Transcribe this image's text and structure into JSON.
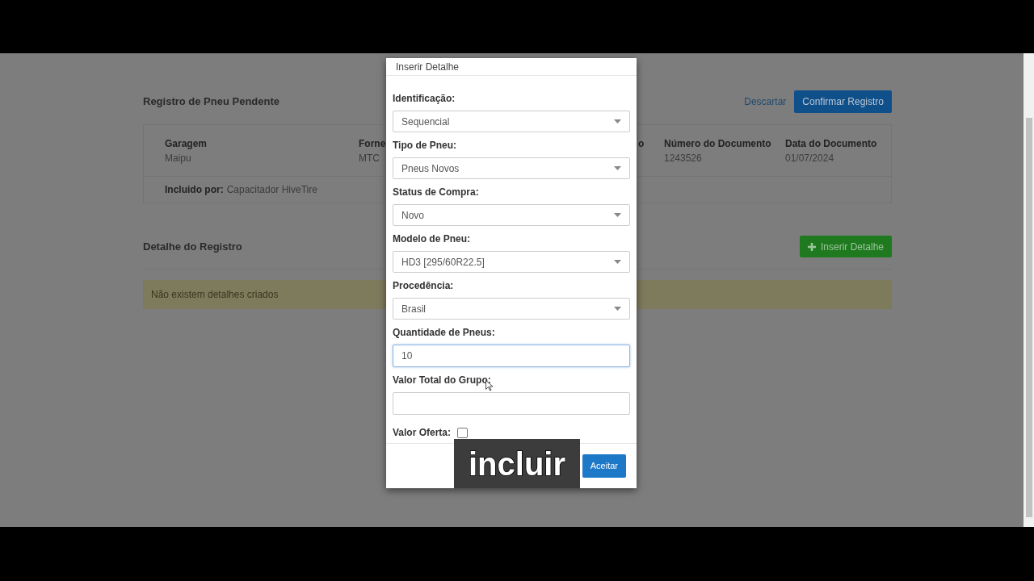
{
  "page": {
    "title": "Registro de Pneu Pendente",
    "actions": [
      {
        "label": "Descartar",
        "kind": "link"
      },
      {
        "label": "Confirmar Registro",
        "kind": "primary"
      }
    ],
    "info": [
      {
        "label": "Garagem",
        "value": "Maipu"
      },
      {
        "label": "Forne",
        "value": "MTC"
      },
      {
        "label": "o"
      },
      {
        "label": "Número do Documento",
        "value": "1243526"
      },
      {
        "label": "Data do Documento",
        "value": "01/07/2024"
      }
    ],
    "included_by": {
      "label": "Incluido por:",
      "value": "Capacitador HiveTire"
    },
    "detail_title": "Detalhe do Registro",
    "insert_button": "Inserir Detalhe",
    "empty_message": "Não existem detalhes criados"
  },
  "modal": {
    "title": "Inserir Detalhe",
    "fields": [
      {
        "kind": "select",
        "label": "Identificação:",
        "value": "Sequencial"
      },
      {
        "kind": "select",
        "label": "Tipo de Pneu:",
        "value": "Pneus Novos"
      },
      {
        "kind": "select",
        "label": "Status de Compra:",
        "value": "Novo"
      },
      {
        "kind": "select",
        "label": "Modelo de Pneu:",
        "value": "HD3 [295/60R22.5]"
      },
      {
        "kind": "select",
        "label": "Procedência:",
        "value": "Brasil"
      },
      {
        "kind": "input",
        "label": "Quantidade de Pneus:",
        "value": "10",
        "focused": true
      },
      {
        "kind": "input",
        "label": "Valor Total do Grupo:",
        "focused": false
      },
      {
        "kind": "checkbox",
        "label": "Valor Oferta:",
        "checked": false
      }
    ],
    "accept_button": "Aceitar"
  },
  "caption": "incluir"
}
